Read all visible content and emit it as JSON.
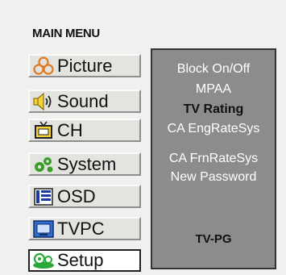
{
  "menu": {
    "title": "MAIN MENU",
    "items": [
      {
        "label": "Picture",
        "icon": "picture-icon"
      },
      {
        "label": "Sound",
        "icon": "sound-icon"
      },
      {
        "label": "CH",
        "icon": "tv-channel-icon"
      },
      {
        "label": "System",
        "icon": "system-icon"
      },
      {
        "label": "OSD",
        "icon": "osd-icon"
      },
      {
        "label": "TVPC",
        "icon": "tvpc-icon"
      },
      {
        "label": "Setup",
        "icon": "setup-icon"
      }
    ],
    "selected": "Setup"
  },
  "submenu": {
    "options": [
      "Block On/Off",
      "MPAA",
      "TV Rating",
      "CA EngRateSys",
      "CA FrnRateSys",
      "New Password"
    ],
    "highlighted": "TV Rating",
    "current_value": "TV-PG"
  },
  "colors": {
    "panel_background": "#8c8c8c",
    "option_text": "#ffffff",
    "highlight_text": "#111111",
    "picture_icon": "#e07a1f",
    "sound_icon": "#f2d13a",
    "system_icon": "#3a9d2a",
    "osd_icon": "#1b3aa8",
    "tvpc_icon": "#2e6fd0",
    "setup_icon": "#2aa838"
  }
}
